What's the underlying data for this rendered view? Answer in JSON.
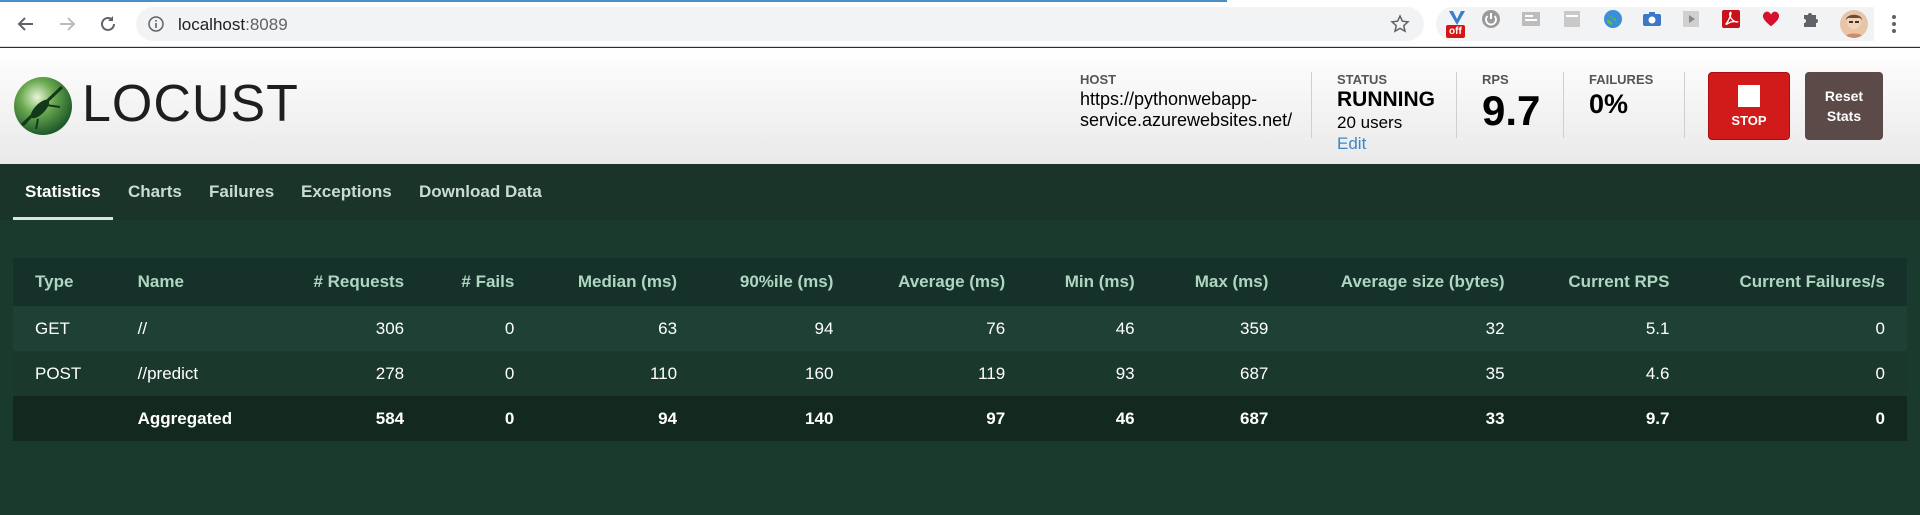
{
  "browser": {
    "url_host": "localhost",
    "url_port": ":8089",
    "ext_badge": "off"
  },
  "app": {
    "brand": "LOCUST"
  },
  "stats": {
    "host_label": "HOST",
    "host_value": "https://pythonwebapp-service.azurewebsites.net/",
    "status_label": "STATUS",
    "status_value": "RUNNING",
    "users": "20 users",
    "edit": "Edit",
    "rps_label": "RPS",
    "rps_value": "9.7",
    "failures_label": "FAILURES",
    "failures_value": "0%"
  },
  "buttons": {
    "stop": "STOP",
    "reset": "Reset Stats"
  },
  "tabs": [
    "Statistics",
    "Charts",
    "Failures",
    "Exceptions",
    "Download Data"
  ],
  "table": {
    "headers": [
      "Type",
      "Name",
      "# Requests",
      "# Fails",
      "Median (ms)",
      "90%ile (ms)",
      "Average (ms)",
      "Min (ms)",
      "Max (ms)",
      "Average size (bytes)",
      "Current RPS",
      "Current Failures/s"
    ],
    "rows": [
      [
        "GET",
        "//",
        "306",
        "0",
        "63",
        "94",
        "76",
        "46",
        "359",
        "32",
        "5.1",
        "0"
      ],
      [
        "POST",
        "//predict",
        "278",
        "0",
        "110",
        "160",
        "119",
        "93",
        "687",
        "35",
        "4.6",
        "0"
      ],
      [
        "",
        "Aggregated",
        "584",
        "0",
        "94",
        "140",
        "97",
        "46",
        "687",
        "33",
        "9.7",
        "0"
      ]
    ]
  }
}
